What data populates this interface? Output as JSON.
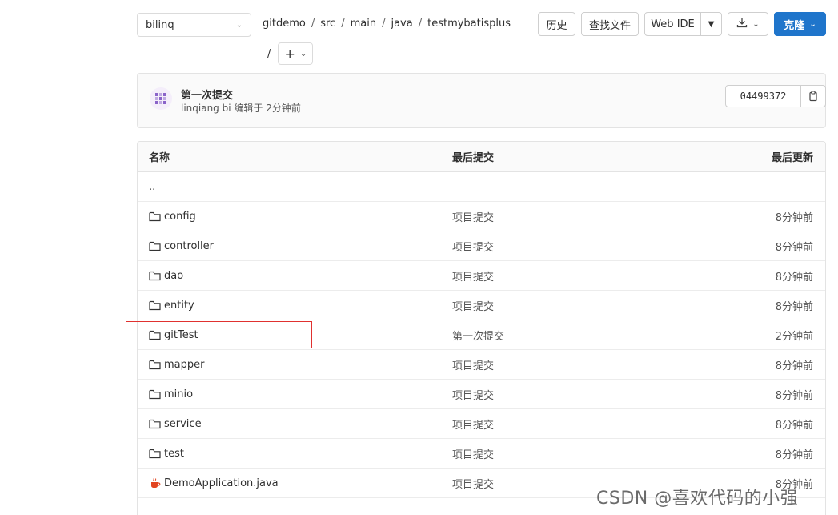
{
  "branch": {
    "name": "bilinq"
  },
  "breadcrumb": {
    "items": [
      "gitdemo",
      "src",
      "main",
      "java",
      "testmybatisplus"
    ],
    "separator": "/",
    "add_label": "+"
  },
  "toolbar": {
    "history": "历史",
    "find_file": "查找文件",
    "web_ide": "Web IDE",
    "clone": "克隆"
  },
  "commit": {
    "title": "第一次提交",
    "author": "linqiang bi",
    "meta": "编辑于 2分钟前",
    "sha": "04499372"
  },
  "table": {
    "headers": {
      "name": "名称",
      "last_commit": "最后提交",
      "last_update": "最后更新"
    },
    "parent": "..",
    "rows": [
      {
        "name": "config",
        "commit": "项目提交",
        "updated": "8分钟前",
        "icon": "folder-icon"
      },
      {
        "name": "controller",
        "commit": "项目提交",
        "updated": "8分钟前",
        "icon": "folder-icon"
      },
      {
        "name": "dao",
        "commit": "项目提交",
        "updated": "8分钟前",
        "icon": "folder-icon"
      },
      {
        "name": "entity",
        "commit": "项目提交",
        "updated": "8分钟前",
        "icon": "folder-icon"
      },
      {
        "name": "gitTest",
        "commit": "第一次提交",
        "updated": "2分钟前",
        "icon": "folder-icon"
      },
      {
        "name": "mapper",
        "commit": "项目提交",
        "updated": "8分钟前",
        "icon": "folder-icon"
      },
      {
        "name": "minio",
        "commit": "项目提交",
        "updated": "8分钟前",
        "icon": "folder-icon"
      },
      {
        "name": "service",
        "commit": "项目提交",
        "updated": "8分钟前",
        "icon": "folder-icon"
      },
      {
        "name": "test",
        "commit": "项目提交",
        "updated": "8分钟前",
        "icon": "folder-icon"
      },
      {
        "name": "DemoApplication.java",
        "commit": "项目提交",
        "updated": "8分钟前",
        "icon": "java-file-icon"
      }
    ]
  },
  "watermark": "CSDN @喜欢代码的小强",
  "colors": {
    "accent": "#1f75cb",
    "highlight": "#e0312f"
  }
}
